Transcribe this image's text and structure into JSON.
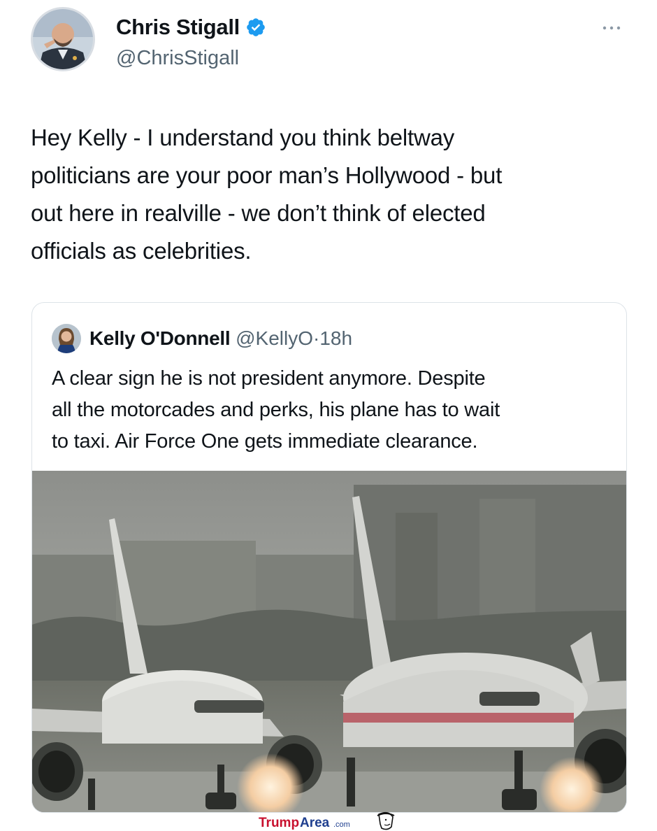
{
  "author": {
    "display_name": "Chris Stigall",
    "handle": "@ChrisStigall",
    "verified_icon": "verified-badge-icon",
    "more_icon": "more-dots-icon"
  },
  "tweet": {
    "text": "Hey Kelly - I understand you think beltway\npoliticians are your poor man’s Hollywood - but\nout here in realville - we don’t think of elected\nofficials as celebrities."
  },
  "quoted": {
    "display_name": "Kelly O'Donnell",
    "handle": "@KellyO",
    "separator": "·",
    "time": "18h",
    "text": "A clear sign he is not president anymore.  Despite\nall the motorcades and perks, his plane has to wait\nto taxi.  Air Force One gets immediate clearance."
  },
  "watermark": {
    "brand_trump": "Trump",
    "brand_area": "Area",
    "brand_com": ".com",
    "trump_color": "#c8102e",
    "area_color": "#1f3f8f"
  },
  "colors": {
    "verified_blue": "#1d9bf0",
    "secondary_text": "#536471",
    "primary_text": "#0f1419"
  }
}
